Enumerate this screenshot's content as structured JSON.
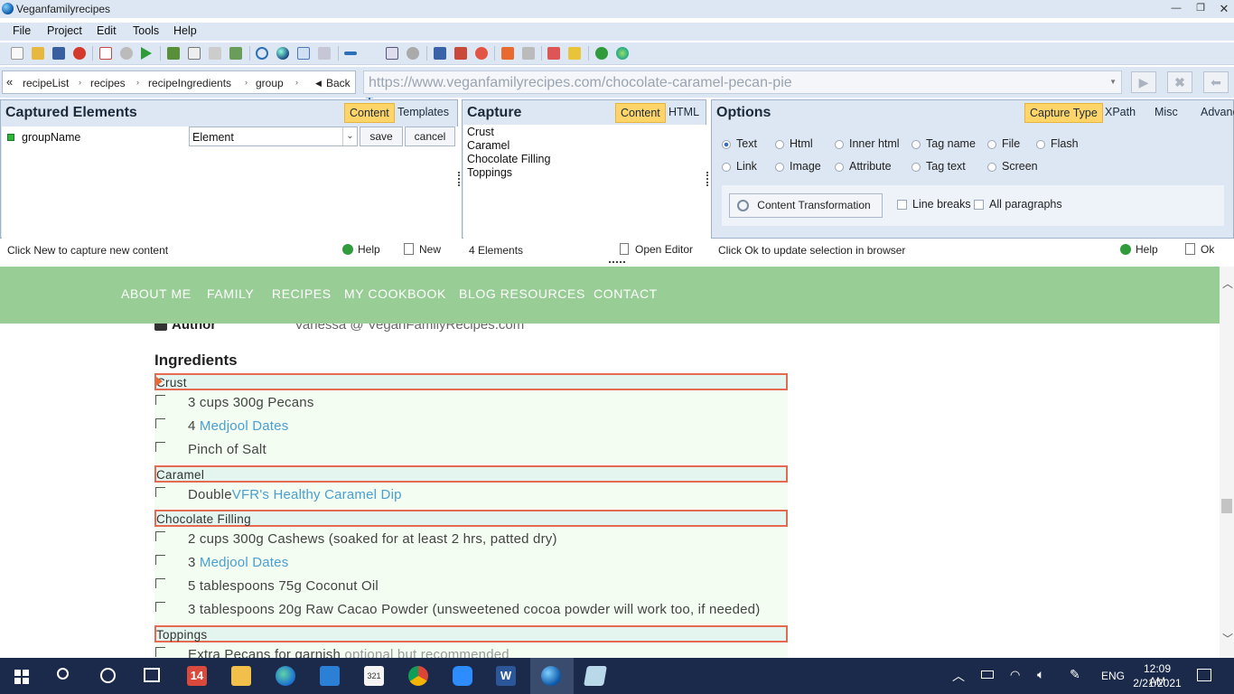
{
  "window": {
    "title": "Veganfamilyrecipes"
  },
  "menu": [
    "File",
    "Project",
    "Edit",
    "Tools",
    "Help"
  ],
  "breadcrumb": {
    "items": [
      "recipeList",
      "recipes",
      "recipeIngredients",
      "group"
    ],
    "back": "Back"
  },
  "url": "https://www.veganfamilyrecipes.com/chocolate-caramel-pecan-pie",
  "captured": {
    "title": "Captured Elements",
    "tabs": [
      "Content",
      "Templates"
    ],
    "field_name": "groupName",
    "field_type": "Element",
    "save": "save",
    "cancel": "cancel",
    "status": "Click New to capture new content",
    "help": "Help",
    "new": "New"
  },
  "capture": {
    "title": "Capture",
    "tabs": [
      "Content",
      "HTML"
    ],
    "items": [
      "Crust",
      "Caramel",
      "Chocolate Filling",
      "Toppings"
    ],
    "count": "4 Elements",
    "open_editor": "Open Editor"
  },
  "options": {
    "title": "Options",
    "tabs": [
      "Capture Type",
      "XPath",
      "Misc",
      "Advanced"
    ],
    "radios_row1": [
      "Text",
      "Html",
      "Inner html",
      "Tag name",
      "File",
      "Flash"
    ],
    "radios_row2": [
      "Link",
      "Image",
      "Attribute",
      "Tag text",
      "Screen"
    ],
    "transform": "Content Transformation",
    "line_breaks": "Line breaks",
    "all_paragraphs": "All paragraphs",
    "status": "Click Ok to update selection in browser",
    "help": "Help",
    "ok": "Ok"
  },
  "site": {
    "nav": [
      "ABOUT ME",
      "FAMILY",
      "RECIPES",
      "MY COOKBOOK",
      "BLOG RESOURCES",
      "CONTACT"
    ],
    "author_label": "Author",
    "author_value": "Vanessa @ VeganFamilyRecipes.com",
    "ingredients_heading": "Ingredients",
    "groups": {
      "crust": "Crust",
      "caramel": "Caramel",
      "filling": "Chocolate Filling",
      "toppings": "Toppings"
    },
    "crust_1": "3 cups 300g Pecans",
    "crust_2_pre": "4 ",
    "crust_2_link": "Medjool Dates",
    "crust_3": "Pinch of Salt",
    "caramel_1_pre": "Double",
    "caramel_1_link": "VFR's Healthy Caramel Dip",
    "filling_1": "2 cups 300g Cashews (soaked for at least 2 hrs, patted dry)",
    "filling_2_pre": "3 ",
    "filling_2_link": "Medjool Dates",
    "filling_3": "5 tablespoons 75g Coconut Oil",
    "filling_4": "3 tablespoons 20g Raw Cacao Powder (unsweetened cocoa powder will work too, if needed)",
    "toppings_1": "Extra Pecans for garnish",
    "toppings_1_note": "optional but recommended"
  },
  "taskbar": {
    "badge": "14",
    "lang": "ENG",
    "time": "12:09 AM",
    "date": "2/21/2021"
  },
  "colors": {
    "accent_tab": "#ffd56a",
    "site_nav": "#99cd96",
    "highlight_border": "#e46a52",
    "link": "#4a9fd1"
  }
}
